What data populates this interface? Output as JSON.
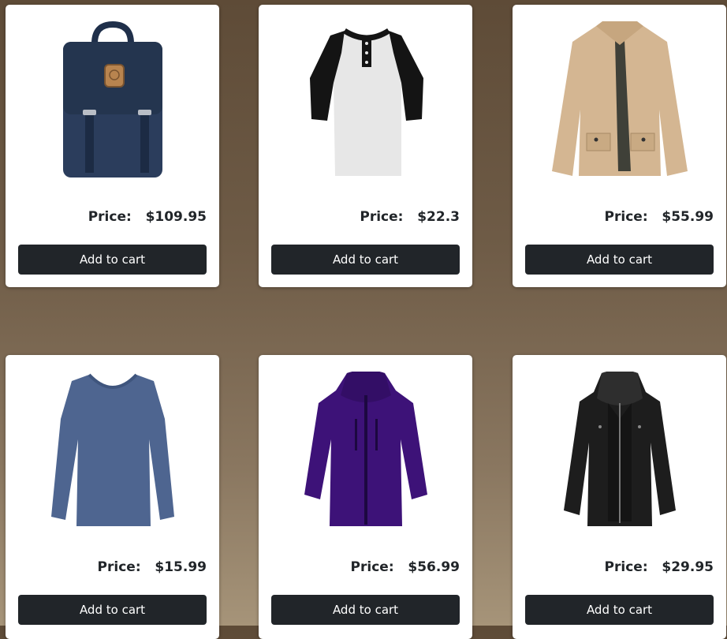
{
  "products": [
    {
      "image": "navy-backpack-image",
      "price_label": "Price:",
      "price": "$109.95",
      "button": "Add to cart"
    },
    {
      "image": "raglan-henley-shirt-image",
      "price_label": "Price:",
      "price": "$22.3",
      "button": "Add to cart"
    },
    {
      "image": "khaki-cotton-jacket-image",
      "price_label": "Price:",
      "price": "$55.99",
      "button": "Add to cart"
    },
    {
      "image": "blue-longsleeve-tee-image",
      "price_label": "Price:",
      "price": "$15.99",
      "button": "Add to cart"
    },
    {
      "image": "purple-rain-jacket-image",
      "price_label": "Price:",
      "price": "$56.99",
      "button": "Add to cart"
    },
    {
      "image": "black-leather-jacket-image",
      "price_label": "Price:",
      "price": "$29.95",
      "button": "Add to cart"
    }
  ],
  "colors": {
    "button_bg": "#212529",
    "card_bg": "#ffffff",
    "text": "#212529"
  }
}
